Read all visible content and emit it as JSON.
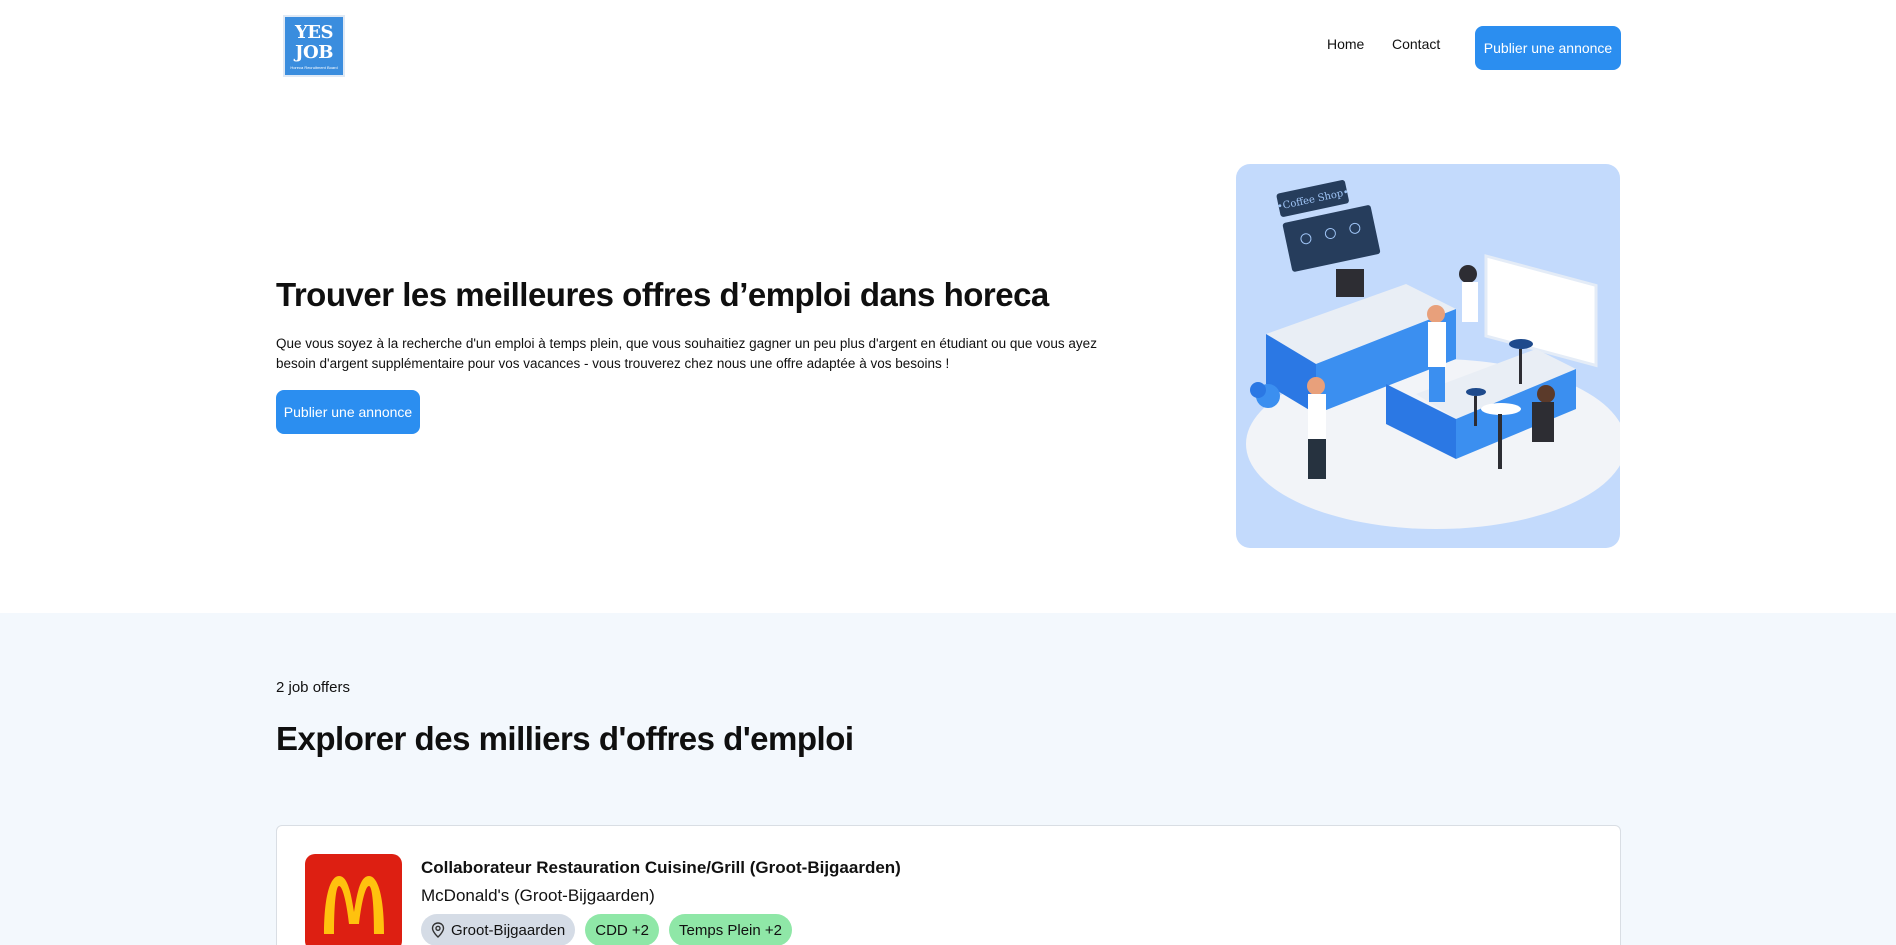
{
  "header": {
    "logo": {
      "line1": "YES",
      "line2": "JOB",
      "line3": "Horeca Recruitment Board"
    },
    "nav": {
      "home": "Home",
      "contact": "Contact"
    },
    "cta_label": "Publier une annonce"
  },
  "hero": {
    "title": "Trouver les meilleures offres d’emploi dans horeca",
    "description": "Que vous soyez à la recherche d'un emploi à temps plein, que vous souhaitiez gagner un peu plus d'argent en étudiant ou que vous ayez besoin d'argent supplémentaire pour vos vacances - vous trouverez chez nous une offre adaptée à vos besoins !",
    "cta_label": "Publier une annonce",
    "illustration": {
      "sign_text": "•Coffee Shop•"
    }
  },
  "listing": {
    "count_label": "2 job offers",
    "title": "Explorer des milliers d'offres d'emploi",
    "jobs": [
      {
        "title": "Collaborateur Restauration Cuisine/Grill (Groot-Bijgaarden)",
        "company": "McDonald's (Groot-Bijgaarden)",
        "location": "Groot-Bijgaarden",
        "contract": "CDD +2",
        "schedule": "Temps Plein +2"
      }
    ]
  },
  "colors": {
    "primary": "#2b8ef0",
    "section_bg": "#f3f8fd",
    "illustration_bg": "#c3dafc",
    "tag_location": "#d5dce6",
    "tag_green": "#8fe7a7",
    "mcdonalds_red": "#dd1f12",
    "mcdonalds_yellow": "#ffc20e"
  }
}
